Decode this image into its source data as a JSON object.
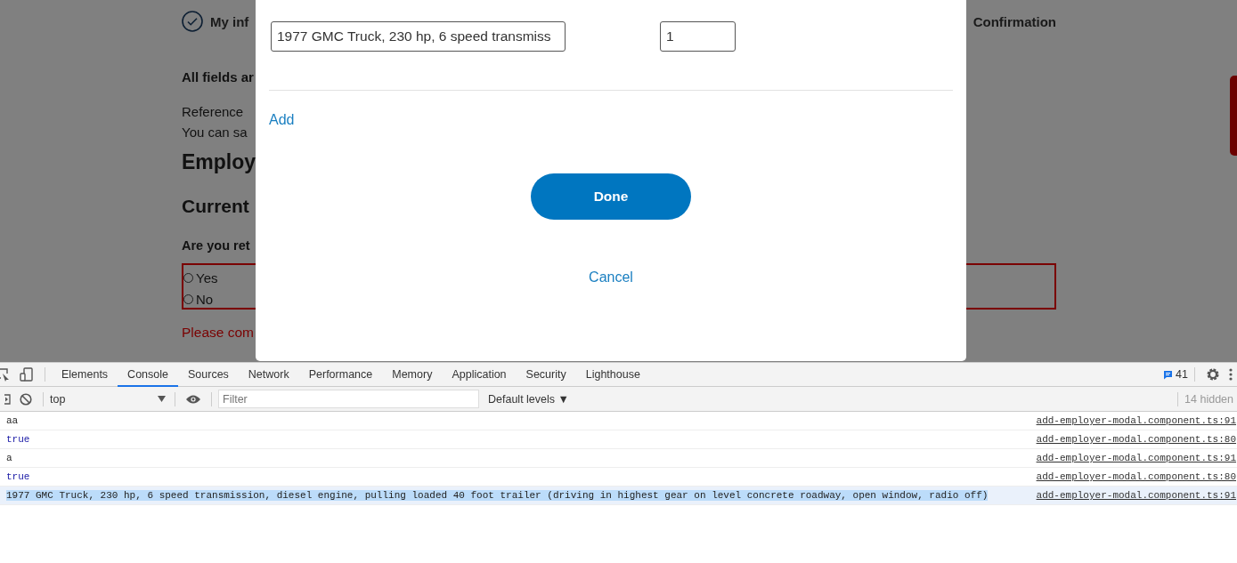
{
  "page": {
    "steps": [
      {
        "label": "My inf",
        "done": true
      },
      {
        "label": "Confirmation"
      }
    ],
    "required_note": "All fields ar",
    "reference_note": "Reference",
    "save_note": "You can sa",
    "heading": "Employ",
    "subheading": "Current",
    "question": "Are you ret",
    "options": [
      {
        "label": "Yes",
        "selected": false
      },
      {
        "label": "No",
        "selected": false
      }
    ],
    "error": "Please com"
  },
  "modal": {
    "description_value": "1977 GMC Truck, 230 hp, 6 speed transmiss",
    "quantity_value": "1",
    "add_link": "Add",
    "done_button": "Done",
    "cancel_link": "Cancel"
  },
  "devtools": {
    "tabs": [
      {
        "label": "Elements",
        "selected": false
      },
      {
        "label": "Console",
        "selected": true
      },
      {
        "label": "Sources",
        "selected": false
      },
      {
        "label": "Network",
        "selected": false
      },
      {
        "label": "Performance",
        "selected": false
      },
      {
        "label": "Memory",
        "selected": false
      },
      {
        "label": "Application",
        "selected": false
      },
      {
        "label": "Security",
        "selected": false
      },
      {
        "label": "Lighthouse",
        "selected": false
      }
    ],
    "message_count": "41",
    "context": "top",
    "filter_placeholder": "Filter",
    "levels": "Default levels ▼",
    "hidden_count": "14 hidden",
    "console": [
      {
        "kind": "string",
        "text": "aa",
        "source": "add-employer-modal.component.ts:91",
        "selected": false
      },
      {
        "kind": "boolean",
        "text": "true",
        "source": "add-employer-modal.component.ts:80",
        "selected": false
      },
      {
        "kind": "string",
        "text": "a",
        "source": "add-employer-modal.component.ts:91",
        "selected": false
      },
      {
        "kind": "boolean",
        "text": "true",
        "source": "add-employer-modal.component.ts:80",
        "selected": false
      },
      {
        "kind": "string",
        "text": "1977 GMC Truck, 230 hp, 6 speed transmission, diesel engine, pulling loaded 40 foot trailer (driving in highest gear on level concrete roadway, open window, radio off)",
        "source": "add-employer-modal.component.ts:91",
        "selected": true
      }
    ]
  }
}
